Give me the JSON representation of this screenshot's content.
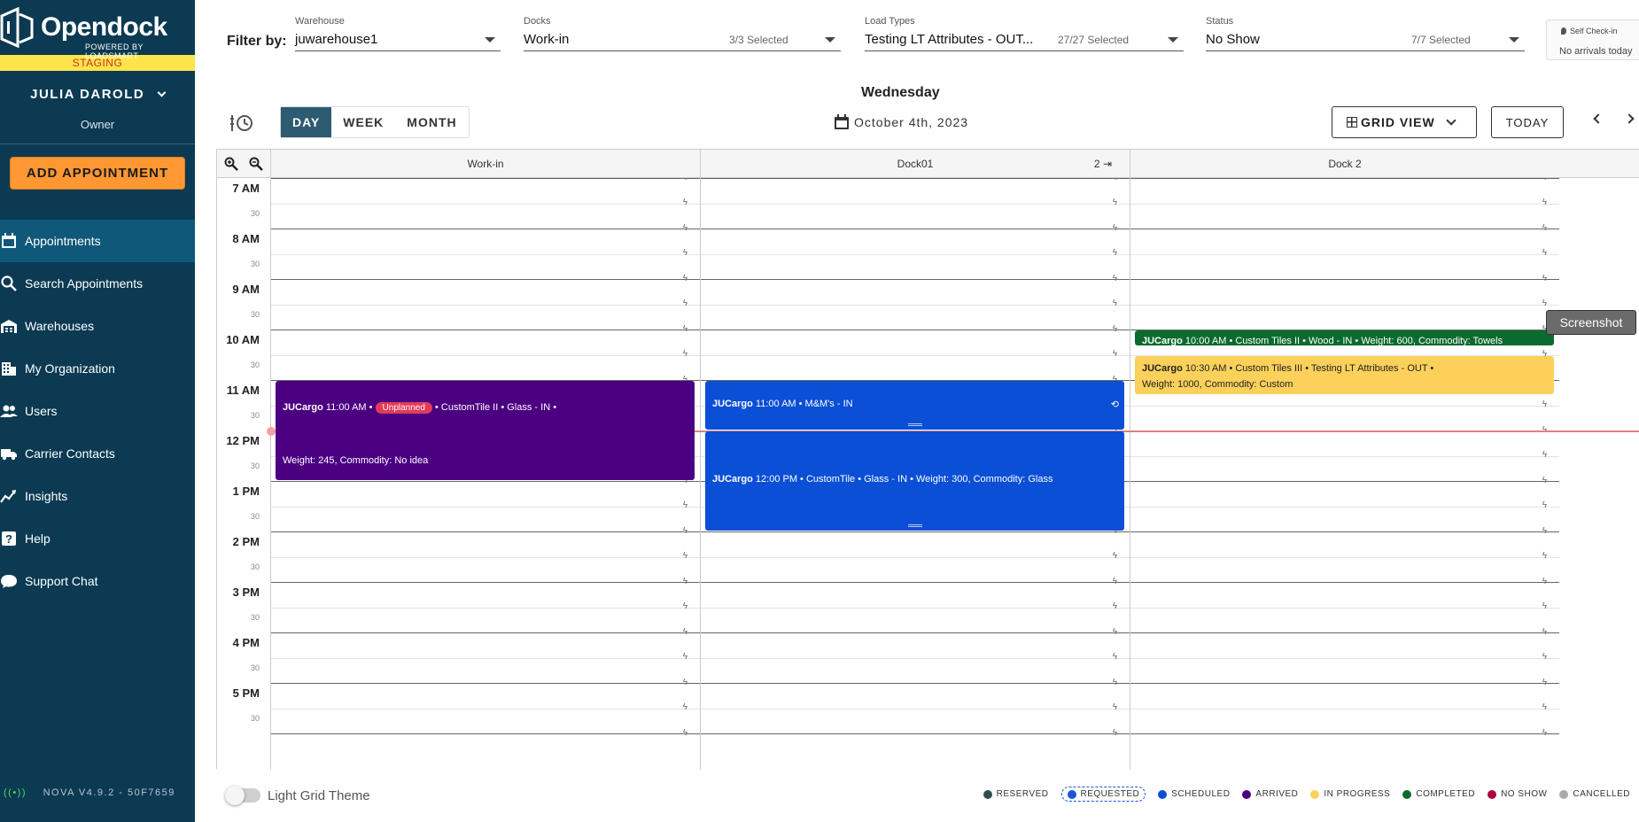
{
  "brand": {
    "name": "Opendock",
    "tagline": "POWERED BY LOADSMART",
    "env": "STAGING"
  },
  "user": {
    "name": "JULIA DAROLD",
    "role": "Owner"
  },
  "add_appointment_label": "ADD APPOINTMENT",
  "nav": [
    {
      "label": "Appointments",
      "icon": "calendar-icon",
      "active": true
    },
    {
      "label": "Search Appointments",
      "icon": "search-icon"
    },
    {
      "label": "Warehouses",
      "icon": "warehouse-icon"
    },
    {
      "label": "My Organization",
      "icon": "building-icon"
    },
    {
      "label": "Users",
      "icon": "users-icon"
    },
    {
      "label": "Carrier Contacts",
      "icon": "truck-icon"
    },
    {
      "label": "Insights",
      "icon": "chart-icon"
    },
    {
      "label": "Help",
      "icon": "help-icon"
    },
    {
      "label": "Support Chat",
      "icon": "chat-icon"
    }
  ],
  "version": "NOVA V4.9.2 - 50F7659",
  "filters": {
    "label": "Filter by:",
    "warehouse": {
      "label": "Warehouse",
      "value": "juwarehouse1"
    },
    "docks": {
      "label": "Docks",
      "value": "Work-in",
      "count": "3/3 Selected"
    },
    "load_types": {
      "label": "Load Types",
      "value": "Testing LT Attributes - OUT...",
      "count": "27/27 Selected"
    },
    "status": {
      "label": "Status",
      "value": "No Show",
      "count": "7/7 Selected"
    }
  },
  "self_checkin": {
    "label": "Self Check-in",
    "status": "No arrivals today"
  },
  "view_tabs": [
    "DAY",
    "WEEK",
    "MONTH"
  ],
  "active_tab": "DAY",
  "day_name": "Wednesday",
  "date": "October 4th, 2023",
  "grid_view_label": "GRID VIEW",
  "today_label": "TODAY",
  "columns": [
    {
      "name": "Work-in"
    },
    {
      "name": "Dock01",
      "extra": "2"
    },
    {
      "name": "Dock 2"
    }
  ],
  "time_slots": [
    {
      "hour": "7 AM",
      "half": "30"
    },
    {
      "hour": "8 AM",
      "half": "30"
    },
    {
      "hour": "9 AM",
      "half": "30"
    },
    {
      "hour": "10 AM",
      "half": "30"
    },
    {
      "hour": "11 AM",
      "half": "30"
    },
    {
      "hour": "12 PM",
      "half": "30"
    },
    {
      "hour": "1 PM",
      "half": "30"
    },
    {
      "hour": "2 PM",
      "half": "30"
    },
    {
      "hour": "3 PM",
      "half": "30"
    },
    {
      "hour": "4 PM",
      "half": "30"
    },
    {
      "hour": "5 PM",
      "half": "30"
    }
  ],
  "appointments": [
    {
      "column": 0,
      "start_hour": 11.0,
      "end_hour": 13.0,
      "color": "#4b0082",
      "carrier": "JUCargo",
      "line1": "11:00 AM •",
      "badge": "Unplanned",
      "line1b": "• CustomTile II • Glass - IN •",
      "line2": "Weight: 245, Commodity: No idea"
    },
    {
      "column": 1,
      "start_hour": 11.0,
      "end_hour": 12.0,
      "color": "#0b4fd6",
      "carrier": "JUCargo",
      "line1": "11:00 AM • M&M's - IN",
      "recurring": true
    },
    {
      "column": 1,
      "start_hour": 12.0,
      "end_hour": 14.0,
      "color": "#0b4fd6",
      "carrier": "JUCargo",
      "line1": "12:00 PM • CustomTile • Glass - IN • Weight: 300, Commodity: Glass"
    },
    {
      "column": 2,
      "start_hour": 10.0,
      "end_hour": 10.33,
      "color": "#0b6b2e",
      "carrier": "JUCargo",
      "line1": "10:00 AM • Custom Tiles II • Wood - IN • Weight: 600, Commodity: Towels"
    },
    {
      "column": 2,
      "start_hour": 10.5,
      "end_hour": 11.3,
      "color": "#fbd15b",
      "dark_text": true,
      "carrier": "JUCargo",
      "line1": "10:30 AM • Custom Tiles III • Testing LT Attributes - OUT •",
      "line2": "Weight: 1000, Commodity: Custom"
    }
  ],
  "now_hour": 12.0,
  "screenshot_label": "Screenshot",
  "light_grid_label": "Light Grid Theme",
  "light_grid_on": false,
  "legend": [
    {
      "label": "RESERVED",
      "color": "#2f4f4f"
    },
    {
      "label": "REQUESTED",
      "color": "#1a56d6",
      "dashed": true
    },
    {
      "label": "SCHEDULED",
      "color": "#0b4fd6"
    },
    {
      "label": "ARRIVED",
      "color": "#4b0082"
    },
    {
      "label": "IN PROGRESS",
      "color": "#fbd15b"
    },
    {
      "label": "COMPLETED",
      "color": "#0b6b2e"
    },
    {
      "label": "NO SHOW",
      "color": "#b0003a"
    },
    {
      "label": "CANCELLED",
      "color": "#aaaaaa"
    }
  ]
}
